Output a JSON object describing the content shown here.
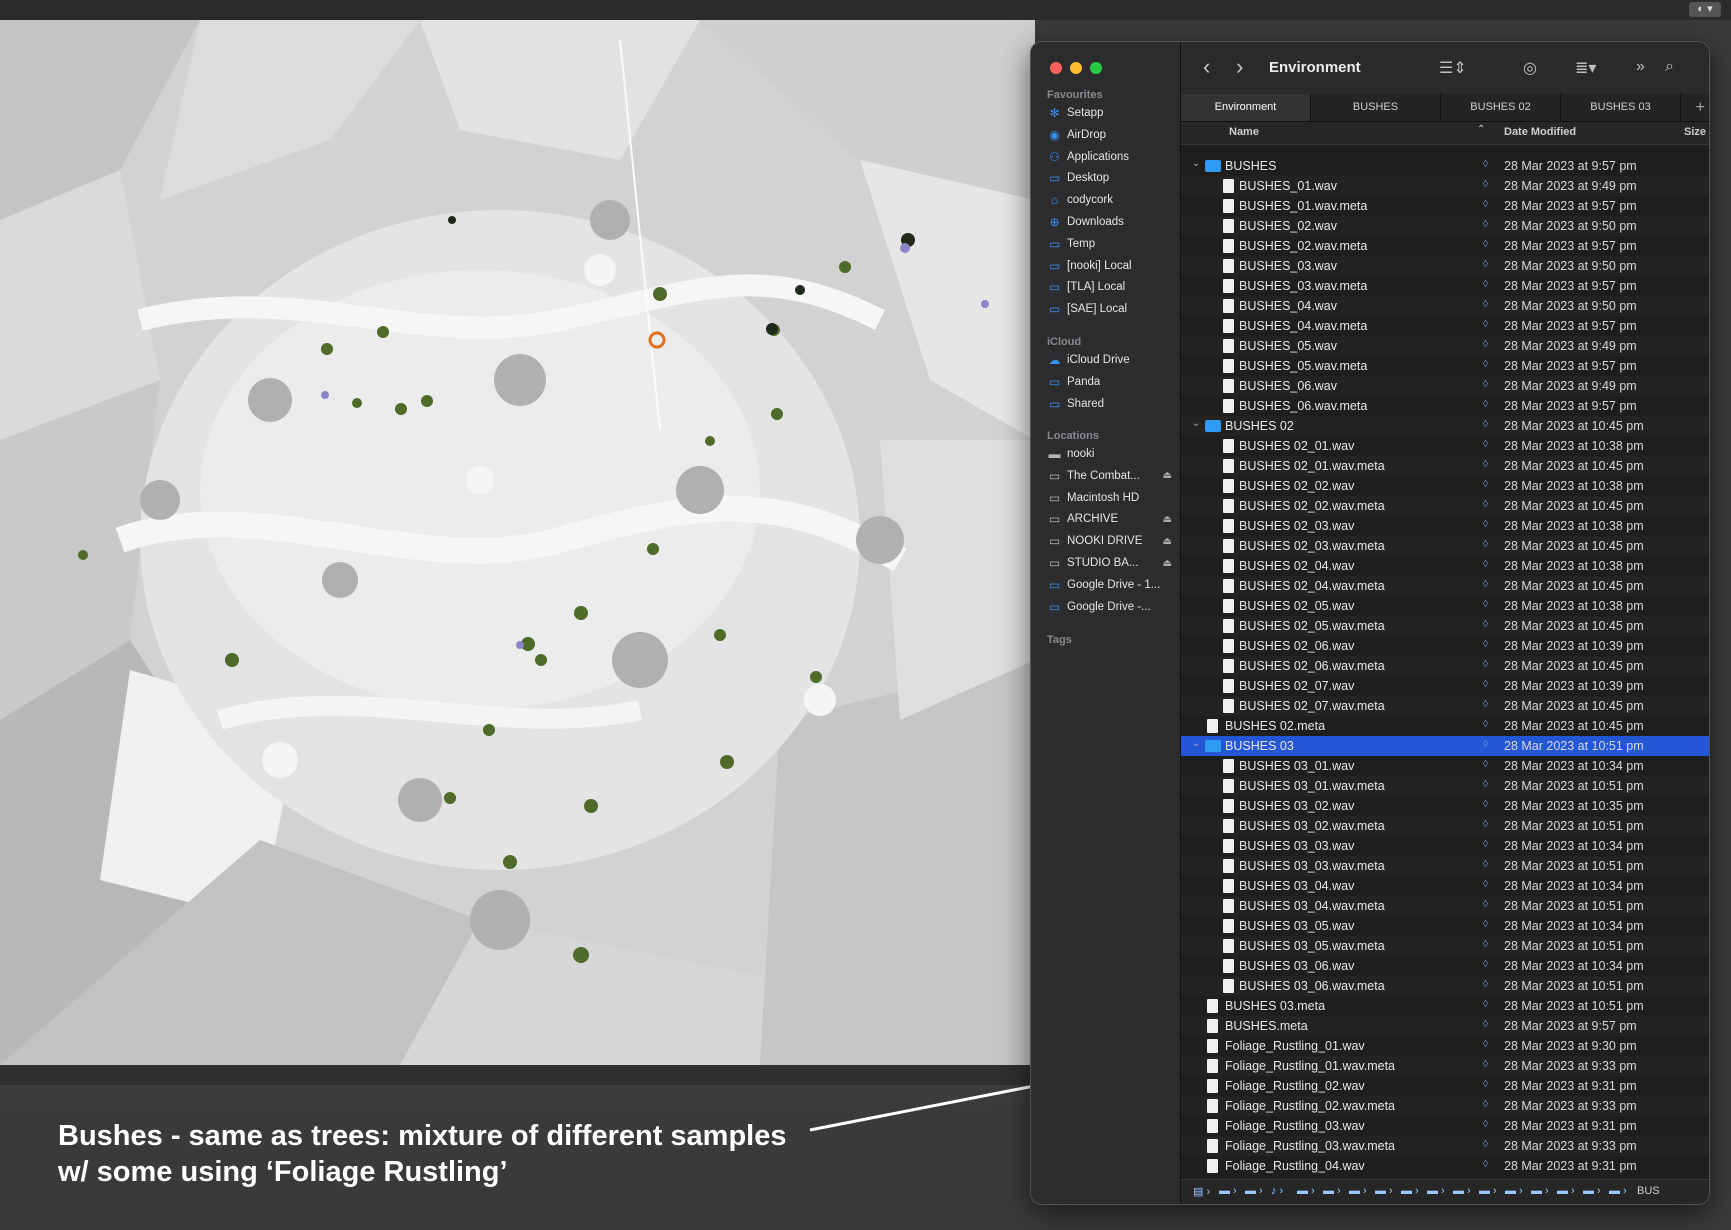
{
  "finder": {
    "title": "Environment",
    "sidebar": {
      "favourites_header": "Favourites",
      "favourites": [
        {
          "label": "Setapp",
          "icon": "setapp-icon"
        },
        {
          "label": "AirDrop",
          "icon": "airdrop-icon"
        },
        {
          "label": "Applications",
          "icon": "applications-icon"
        },
        {
          "label": "Desktop",
          "icon": "desktop-icon"
        },
        {
          "label": "codycork",
          "icon": "home-icon"
        },
        {
          "label": "Downloads",
          "icon": "downloads-icon"
        },
        {
          "label": "Temp",
          "icon": "folder-icon"
        },
        {
          "label": "[nooki] Local",
          "icon": "folder-icon"
        },
        {
          "label": "[TLA] Local",
          "icon": "folder-icon"
        },
        {
          "label": "[SAE] Local",
          "icon": "folder-icon"
        }
      ],
      "icloud_header": "iCloud",
      "icloud": [
        {
          "label": "iCloud Drive",
          "icon": "cloud-icon"
        },
        {
          "label": "Panda",
          "icon": "folder-icon"
        },
        {
          "label": "Shared",
          "icon": "shared-folder-icon"
        }
      ],
      "locations_header": "Locations",
      "locations": [
        {
          "label": "nooki",
          "icon": "computer-icon"
        },
        {
          "label": "The Combat...",
          "icon": "disk-icon",
          "eject": true
        },
        {
          "label": "Macintosh HD",
          "icon": "disk-icon"
        },
        {
          "label": "ARCHIVE",
          "icon": "disk-icon",
          "eject": true
        },
        {
          "label": "NOOKI DRIVE",
          "icon": "disk-icon",
          "eject": true
        },
        {
          "label": "STUDIO BA...",
          "icon": "disk-icon",
          "eject": true
        },
        {
          "label": "Google Drive - 1...",
          "icon": "folder-icon"
        },
        {
          "label": "Google Drive -...",
          "icon": "folder-icon"
        }
      ],
      "tags_header": "Tags"
    },
    "tabs": [
      "Environment",
      "BUSHES",
      "BUSHES 02",
      "BUSHES 03"
    ],
    "columns": {
      "name": "Name",
      "date": "Date Modified",
      "size": "Size"
    },
    "rows": [
      {
        "name": "BUSHES",
        "date": "28 Mar 2023 at 9:57 pm",
        "level": 0,
        "folder": true
      },
      {
        "name": "BUSHES_01.wav",
        "date": "28 Mar 2023 at 9:49 pm",
        "level": 1
      },
      {
        "name": "BUSHES_01.wav.meta",
        "date": "28 Mar 2023 at 9:57 pm",
        "level": 1
      },
      {
        "name": "BUSHES_02.wav",
        "date": "28 Mar 2023 at 9:50 pm",
        "level": 1
      },
      {
        "name": "BUSHES_02.wav.meta",
        "date": "28 Mar 2023 at 9:57 pm",
        "level": 1
      },
      {
        "name": "BUSHES_03.wav",
        "date": "28 Mar 2023 at 9:50 pm",
        "level": 1
      },
      {
        "name": "BUSHES_03.wav.meta",
        "date": "28 Mar 2023 at 9:57 pm",
        "level": 1
      },
      {
        "name": "BUSHES_04.wav",
        "date": "28 Mar 2023 at 9:50 pm",
        "level": 1
      },
      {
        "name": "BUSHES_04.wav.meta",
        "date": "28 Mar 2023 at 9:57 pm",
        "level": 1
      },
      {
        "name": "BUSHES_05.wav",
        "date": "28 Mar 2023 at 9:49 pm",
        "level": 1
      },
      {
        "name": "BUSHES_05.wav.meta",
        "date": "28 Mar 2023 at 9:57 pm",
        "level": 1
      },
      {
        "name": "BUSHES_06.wav",
        "date": "28 Mar 2023 at 9:49 pm",
        "level": 1
      },
      {
        "name": "BUSHES_06.wav.meta",
        "date": "28 Mar 2023 at 9:57 pm",
        "level": 1
      },
      {
        "name": "BUSHES 02",
        "date": "28 Mar 2023 at 10:45 pm",
        "level": 0,
        "folder": true
      },
      {
        "name": "BUSHES 02_01.wav",
        "date": "28 Mar 2023 at 10:38 pm",
        "level": 1
      },
      {
        "name": "BUSHES 02_01.wav.meta",
        "date": "28 Mar 2023 at 10:45 pm",
        "level": 1
      },
      {
        "name": "BUSHES 02_02.wav",
        "date": "28 Mar 2023 at 10:38 pm",
        "level": 1
      },
      {
        "name": "BUSHES 02_02.wav.meta",
        "date": "28 Mar 2023 at 10:45 pm",
        "level": 1
      },
      {
        "name": "BUSHES 02_03.wav",
        "date": "28 Mar 2023 at 10:38 pm",
        "level": 1
      },
      {
        "name": "BUSHES 02_03.wav.meta",
        "date": "28 Mar 2023 at 10:45 pm",
        "level": 1
      },
      {
        "name": "BUSHES 02_04.wav",
        "date": "28 Mar 2023 at 10:38 pm",
        "level": 1
      },
      {
        "name": "BUSHES 02_04.wav.meta",
        "date": "28 Mar 2023 at 10:45 pm",
        "level": 1
      },
      {
        "name": "BUSHES 02_05.wav",
        "date": "28 Mar 2023 at 10:38 pm",
        "level": 1
      },
      {
        "name": "BUSHES 02_05.wav.meta",
        "date": "28 Mar 2023 at 10:45 pm",
        "level": 1
      },
      {
        "name": "BUSHES 02_06.wav",
        "date": "28 Mar 2023 at 10:39 pm",
        "level": 1
      },
      {
        "name": "BUSHES 02_06.wav.meta",
        "date": "28 Mar 2023 at 10:45 pm",
        "level": 1
      },
      {
        "name": "BUSHES 02_07.wav",
        "date": "28 Mar 2023 at 10:39 pm",
        "level": 1
      },
      {
        "name": "BUSHES 02_07.wav.meta",
        "date": "28 Mar 2023 at 10:45 pm",
        "level": 1
      },
      {
        "name": "BUSHES 02.meta",
        "date": "28 Mar 2023 at 10:45 pm",
        "level": 0
      },
      {
        "name": "BUSHES 03",
        "date": "28 Mar 2023 at 10:51 pm",
        "level": 0,
        "folder": true,
        "selected": true
      },
      {
        "name": "BUSHES 03_01.wav",
        "date": "28 Mar 2023 at 10:34 pm",
        "level": 1
      },
      {
        "name": "BUSHES 03_01.wav.meta",
        "date": "28 Mar 2023 at 10:51 pm",
        "level": 1
      },
      {
        "name": "BUSHES 03_02.wav",
        "date": "28 Mar 2023 at 10:35 pm",
        "level": 1
      },
      {
        "name": "BUSHES 03_02.wav.meta",
        "date": "28 Mar 2023 at 10:51 pm",
        "level": 1
      },
      {
        "name": "BUSHES 03_03.wav",
        "date": "28 Mar 2023 at 10:34 pm",
        "level": 1
      },
      {
        "name": "BUSHES 03_03.wav.meta",
        "date": "28 Mar 2023 at 10:51 pm",
        "level": 1
      },
      {
        "name": "BUSHES 03_04.wav",
        "date": "28 Mar 2023 at 10:34 pm",
        "level": 1
      },
      {
        "name": "BUSHES 03_04.wav.meta",
        "date": "28 Mar 2023 at 10:51 pm",
        "level": 1
      },
      {
        "name": "BUSHES 03_05.wav",
        "date": "28 Mar 2023 at 10:34 pm",
        "level": 1
      },
      {
        "name": "BUSHES 03_05.wav.meta",
        "date": "28 Mar 2023 at 10:51 pm",
        "level": 1
      },
      {
        "name": "BUSHES 03_06.wav",
        "date": "28 Mar 2023 at 10:34 pm",
        "level": 1
      },
      {
        "name": "BUSHES 03_06.wav.meta",
        "date": "28 Mar 2023 at 10:51 pm",
        "level": 1
      },
      {
        "name": "BUSHES 03.meta",
        "date": "28 Mar 2023 at 10:51 pm",
        "level": 0
      },
      {
        "name": "BUSHES.meta",
        "date": "28 Mar 2023 at 9:57 pm",
        "level": 0
      },
      {
        "name": "Foliage_Rustling_01.wav",
        "date": "28 Mar 2023 at 9:30 pm",
        "level": 0
      },
      {
        "name": "Foliage_Rustling_01.wav.meta",
        "date": "28 Mar 2023 at 9:33 pm",
        "level": 0
      },
      {
        "name": "Foliage_Rustling_02.wav",
        "date": "28 Mar 2023 at 9:31 pm",
        "level": 0
      },
      {
        "name": "Foliage_Rustling_02.wav.meta",
        "date": "28 Mar 2023 at 9:33 pm",
        "level": 0
      },
      {
        "name": "Foliage_Rustling_03.wav",
        "date": "28 Mar 2023 at 9:31 pm",
        "level": 0
      },
      {
        "name": "Foliage_Rustling_03.wav.meta",
        "date": "28 Mar 2023 at 9:33 pm",
        "level": 0
      },
      {
        "name": "Foliage_Rustling_04.wav",
        "date": "28 Mar 2023 at 9:31 pm",
        "level": 0
      }
    ],
    "pathbar_end": "BUS"
  },
  "caption": {
    "line1": "Bushes - same as trees: mixture of different samples",
    "line2": "w/ some using ‘Foliage Rustling’"
  },
  "colors": {
    "selection": "#2457d6",
    "folder": "#2f9cf4",
    "sidebar_icon": "#3a93f5",
    "bush_green": "#4e6b2a"
  }
}
